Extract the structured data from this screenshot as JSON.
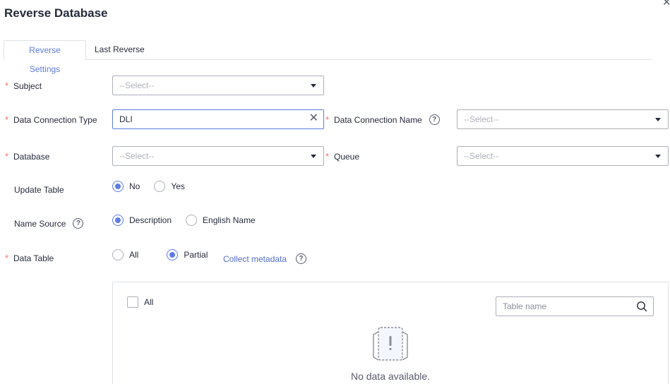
{
  "dialog": {
    "title": "Reverse Database",
    "close_icon": "close-icon"
  },
  "tabs": [
    {
      "label": "Reverse Settings",
      "active": true
    },
    {
      "label": "Last Reverse",
      "active": false
    }
  ],
  "form": {
    "subject": {
      "label": "Subject",
      "placeholder": "--Select--"
    },
    "data_connection_type": {
      "label": "Data Connection Type",
      "value": "DLI"
    },
    "data_connection_name": {
      "label": "Data Connection Name",
      "placeholder": "--Select--"
    },
    "database": {
      "label": "Database",
      "placeholder": "--Select--"
    },
    "queue": {
      "label": "Queue",
      "placeholder": "--Select--"
    },
    "update_table": {
      "label": "Update Table",
      "options": [
        "No",
        "Yes"
      ],
      "selected": "No"
    },
    "name_source": {
      "label": "Name Source",
      "options": [
        "Description",
        "English Name"
      ],
      "selected": "Description"
    },
    "data_table": {
      "label": "Data Table",
      "options": [
        "All",
        "Partial"
      ],
      "selected": "Partial",
      "collect_link": "Collect metadata"
    }
  },
  "table_panel": {
    "select_all_label": "All",
    "search_placeholder": "Table name",
    "empty_text": "No data available."
  },
  "colors": {
    "brand": "#5e7ce0",
    "required": "#f66f6a",
    "link": "#526ecc"
  }
}
